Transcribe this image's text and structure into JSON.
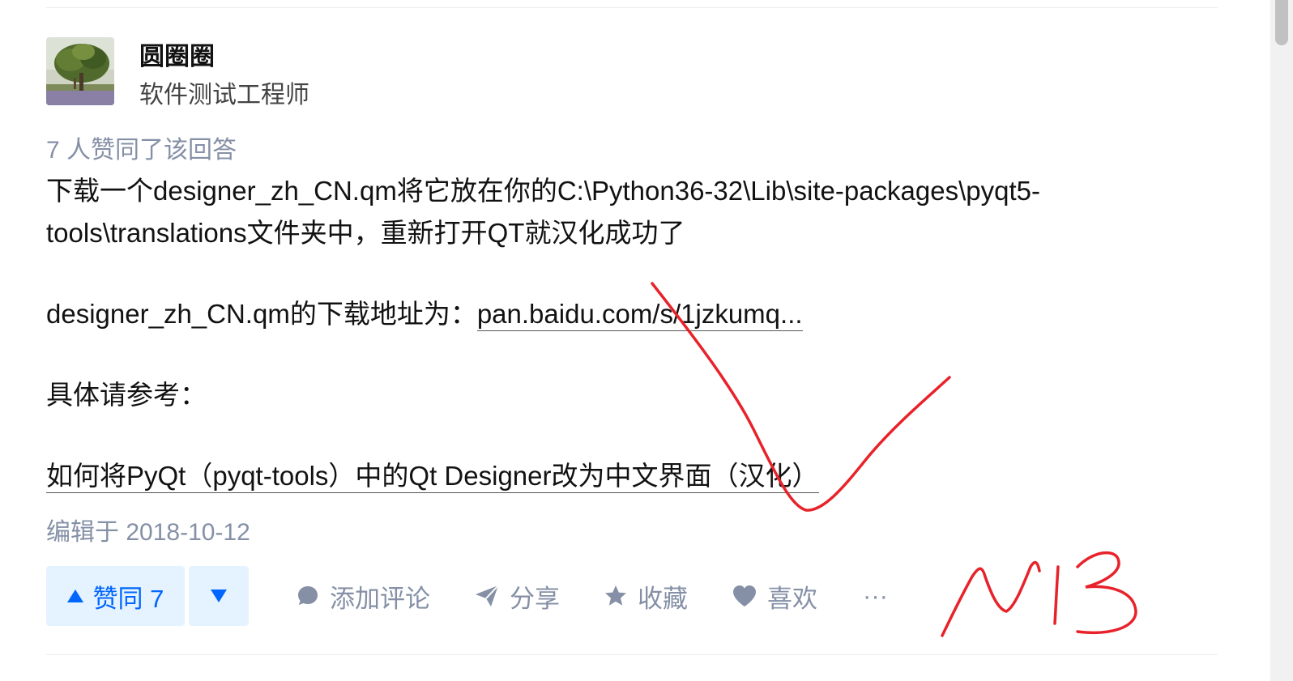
{
  "author": {
    "name": "圆圈圈",
    "bio": "软件测试工程师"
  },
  "vote_info": "7 人赞同了该回答",
  "content": {
    "para1": "下载一个designer_zh_CN.qm将它放在你的C:\\Python36-32\\Lib\\site-packages\\pyqt5-tools\\translations文件夹中，重新打开QT就汉化成功了",
    "para2_prefix": "designer_zh_CN.qm的下载地址为：",
    "para2_link": "pan.baidu.com/s/1jzkumq...",
    "para3": "具体请参考：",
    "para4_link": "如何将PyQt（pyqt-tools）中的Qt Designer改为中文界面（汉化）"
  },
  "edit_time": "编辑于 2018-10-12",
  "actions": {
    "vote_up_label": "赞同 7",
    "comment_label": "添加评论",
    "share_label": "分享",
    "favorite_label": "收藏",
    "like_label": "喜欢",
    "more_label": "···"
  },
  "colors": {
    "accent": "#0066ff",
    "vote_bg": "#e5f2ff",
    "meta": "#8590a6",
    "annotation": "#e8222a"
  },
  "icons": {
    "comment": "comment-bubble-icon",
    "share": "paper-plane-icon",
    "favorite": "star-icon",
    "like": "heart-icon",
    "more": "ellipsis-icon"
  }
}
